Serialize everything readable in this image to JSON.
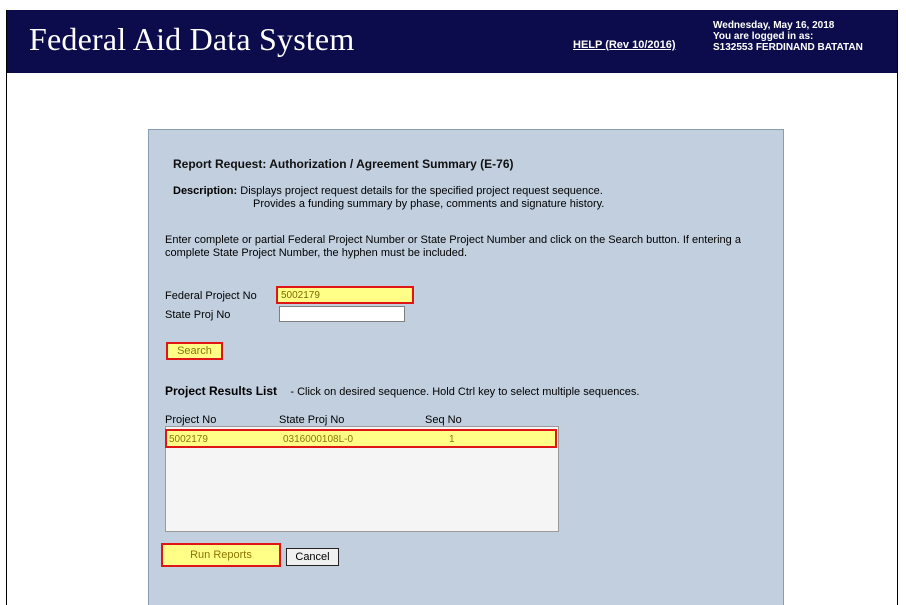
{
  "header": {
    "app_title": "Federal Aid  Data System",
    "help_link": "HELP  (Rev 10/2016)",
    "date": "Wednesday, May 16, 2018",
    "logged_in_label": "You are logged in as:",
    "user": "S132553  FERDINAND  BATATAN"
  },
  "panel": {
    "title": "Report Request: Authorization / Agreement Summary (E-76)",
    "description_label": "Description:",
    "description_line1": "Displays project request details for the specified project request sequence.",
    "description_line2": "Provides a funding summary by phase, comments and signature history.",
    "instructions": "Enter complete or partial Federal Project Number or State Project Number and click on the Search button. If entering a complete State Project Number, the hyphen must be included."
  },
  "form": {
    "federal_project_label": "Federal Project No",
    "federal_project_value": "5002179",
    "state_project_label": "State Proj No",
    "state_project_value": "",
    "search_button": "Search"
  },
  "results": {
    "heading": "Project Results List",
    "hint": "- Click on desired sequence. Hold Ctrl key to select multiple sequences.",
    "columns": [
      "Project No",
      "State Proj No",
      "Seq No"
    ],
    "rows": [
      {
        "project_no": "5002179",
        "state_proj_no": "0316000108L-0",
        "seq_no": "1"
      }
    ]
  },
  "actions": {
    "run_reports": "Run Reports",
    "cancel": "Cancel"
  },
  "colors": {
    "header_bg": "#0c0c4c",
    "panel_bg": "#c1cfdf",
    "highlight_fill": "#ffff88",
    "highlight_border": "#e01515"
  }
}
